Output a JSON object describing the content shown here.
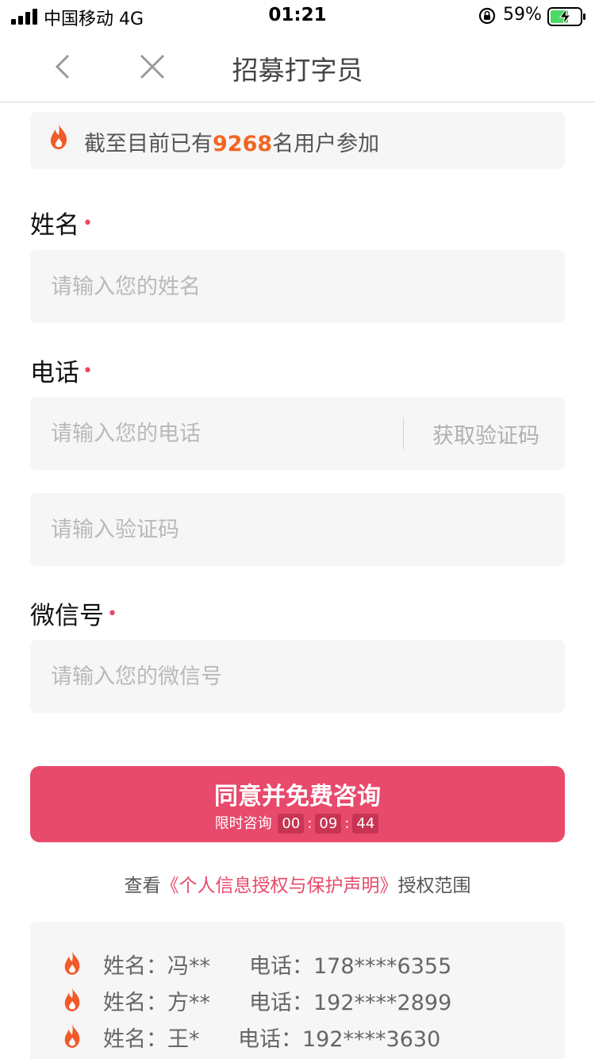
{
  "status_bar": {
    "carrier": "中国移动  4G",
    "time": "01:21",
    "battery": "59%"
  },
  "nav": {
    "title": "招募打字员"
  },
  "notice": {
    "prefix": "截至目前已有",
    "count": "9268",
    "suffix": "名用户参加"
  },
  "form": {
    "name_label": "姓名",
    "name_placeholder": "请输入您的姓名",
    "phone_label": "电话",
    "phone_placeholder": "请输入您的电话",
    "get_code": "获取验证码",
    "code_placeholder": "请输入验证码",
    "wechat_label": "微信号",
    "wechat_placeholder": "请输入您的微信号",
    "required_mark": "•"
  },
  "submit": {
    "label": "同意并免费咨询",
    "limit_text": "限时咨询",
    "hh": "00",
    "mm": "09",
    "ss": "44"
  },
  "agreement": {
    "prefix": "查看",
    "link": "《个人信息授权与保护声明》",
    "suffix": "授权范围"
  },
  "records": [
    {
      "name": "姓名：冯**",
      "phone": "电话：178****6355"
    },
    {
      "name": "姓名：方**",
      "phone": "电话：192****2899"
    },
    {
      "name": "姓名：王*",
      "phone": "电话：192****3630"
    }
  ],
  "colors": {
    "accent": "#e84a6c",
    "count_orange": "#f26522",
    "field_bg": "#f6f6f6"
  }
}
